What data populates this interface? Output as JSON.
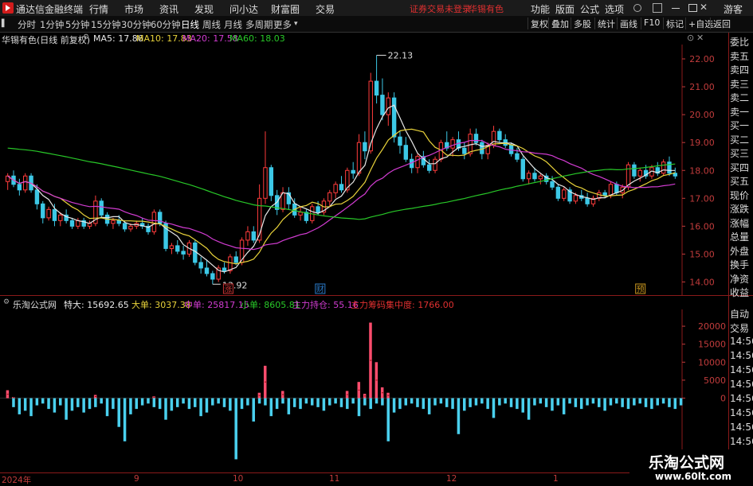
{
  "app": {
    "name": "通达信金融终端",
    "menu": [
      "行情",
      "市场",
      "资讯",
      "发现",
      "问小达",
      "财富圈",
      "交易"
    ],
    "status": "证券交易未登录",
    "stock_name": "华锡有色",
    "right_menu": [
      "功能",
      "版面",
      "公式",
      "选项"
    ],
    "user": "游客"
  },
  "toolbar": {
    "periods": [
      "分时",
      "1分钟",
      "5分钟",
      "15分钟",
      "30分钟",
      "60分钟",
      "日线",
      "周线",
      "月线",
      "多周期",
      "更多"
    ],
    "selected": "日线",
    "right": [
      "复权",
      "叠加",
      "多股",
      "统计",
      "画线",
      "F10",
      "标记",
      "+自选",
      "返回"
    ]
  },
  "main_info": {
    "title": "华锡有色(日线 前复权)",
    "ma": [
      {
        "label": "MA5: 17.86",
        "color": "#e8e8e8"
      },
      {
        "label": "MA10: 17.83",
        "color": "#e8d23a"
      },
      {
        "label": "MA20: 17.58",
        "color": "#d23cd2"
      },
      {
        "label": "MA60: 18.03",
        "color": "#28c828"
      }
    ],
    "high_label": "22.13",
    "low_label": "13.92",
    "markers": [
      "涨",
      "财",
      "预"
    ]
  },
  "sub_info": {
    "title": "乐淘公式网",
    "items": [
      {
        "label": "特大: 15692.65",
        "color": "#e8e8e8"
      },
      {
        "label": "大单: 3037.38",
        "color": "#e8d23a"
      },
      {
        "label": "中单: 25817.15",
        "color": "#d23cd2"
      },
      {
        "label": "小单: 8605.81",
        "color": "#28c828"
      },
      {
        "label": "主力持仓: 55.16",
        "color": "#d23cd2"
      },
      {
        "label": "主力筹码集中度: 1766.00",
        "color": "#e03030"
      }
    ]
  },
  "axis": {
    "price": [
      "22.00",
      "21.00",
      "20.00",
      "19.00",
      "18.00",
      "17.00",
      "16.00",
      "15.00",
      "14.00"
    ],
    "volume": [
      "20000",
      "15000",
      "10000",
      "5000",
      "0"
    ],
    "dates": [
      "2024年",
      "9",
      "10",
      "11",
      "12",
      "1"
    ]
  },
  "right_panel": {
    "top": [
      "委比",
      "卖五",
      "卖四",
      "卖三",
      "卖二",
      "卖一",
      "买一",
      "买二",
      "买三",
      "买四",
      "买五",
      "现价",
      "涨跌",
      "涨幅",
      "总量",
      "外盘",
      "换手",
      "净资",
      "收益"
    ],
    "bottom": [
      "自动",
      "交易",
      "14:56",
      "14:56",
      "14:56",
      "14:56",
      "14:56",
      "14:56",
      "14:56",
      "14:56"
    ]
  },
  "watermark": {
    "name": "乐淘公式网",
    "url": "www.60lt.com"
  },
  "chart_data": {
    "type": "candlestick",
    "y_range": [
      13.7,
      22.4
    ],
    "candles": [
      [
        17.6,
        17.9,
        17.3,
        17.8
      ],
      [
        17.8,
        18.0,
        17.4,
        17.5
      ],
      [
        17.5,
        17.7,
        17.1,
        17.3
      ],
      [
        17.3,
        17.9,
        17.2,
        17.8
      ],
      [
        17.8,
        17.9,
        17.2,
        17.3
      ],
      [
        17.3,
        17.5,
        16.6,
        16.8
      ],
      [
        16.8,
        16.9,
        16.1,
        16.3
      ],
      [
        16.3,
        16.7,
        16.2,
        16.6
      ],
      [
        16.6,
        16.8,
        16.0,
        16.2
      ],
      [
        16.2,
        16.5,
        16.0,
        16.4
      ],
      [
        16.4,
        16.6,
        16.1,
        16.2
      ],
      [
        16.2,
        16.3,
        15.9,
        16.0
      ],
      [
        16.0,
        16.3,
        15.9,
        16.2
      ],
      [
        16.2,
        16.3,
        15.9,
        16.0
      ],
      [
        16.0,
        16.2,
        15.9,
        16.1
      ],
      [
        16.1,
        17.1,
        16.0,
        16.9
      ],
      [
        16.9,
        17.0,
        16.3,
        16.4
      ],
      [
        16.4,
        16.5,
        16.0,
        16.1
      ],
      [
        16.1,
        16.3,
        15.9,
        16.2
      ],
      [
        16.2,
        16.4,
        16.0,
        16.1
      ],
      [
        16.1,
        16.2,
        15.8,
        15.9
      ],
      [
        15.9,
        16.1,
        15.8,
        16.0
      ],
      [
        16.0,
        16.2,
        15.9,
        16.1
      ],
      [
        16.1,
        16.3,
        15.9,
        16.0
      ],
      [
        16.0,
        16.1,
        15.7,
        15.8
      ],
      [
        15.8,
        16.6,
        15.7,
        16.5
      ],
      [
        16.5,
        16.6,
        16.0,
        16.1
      ],
      [
        16.1,
        16.2,
        15.1,
        15.2
      ],
      [
        15.2,
        15.4,
        15.0,
        15.3
      ],
      [
        15.3,
        15.5,
        15.0,
        15.1
      ],
      [
        15.1,
        15.3,
        14.8,
        15.0
      ],
      [
        15.0,
        15.5,
        14.9,
        15.4
      ],
      [
        15.4,
        15.5,
        14.6,
        14.7
      ],
      [
        14.7,
        14.9,
        14.3,
        14.5
      ],
      [
        14.5,
        14.8,
        14.2,
        14.3
      ],
      [
        14.3,
        14.4,
        13.92,
        14.1
      ],
      [
        14.1,
        14.6,
        14.0,
        14.5
      ],
      [
        14.5,
        14.7,
        14.3,
        14.4
      ],
      [
        14.4,
        15.0,
        14.3,
        14.9
      ],
      [
        14.9,
        15.1,
        14.6,
        14.7
      ],
      [
        14.7,
        15.6,
        14.6,
        15.5
      ],
      [
        15.5,
        16.0,
        15.3,
        15.8
      ],
      [
        15.8,
        16.0,
        15.4,
        15.5
      ],
      [
        15.5,
        17.5,
        15.4,
        17.0
      ],
      [
        17.0,
        19.4,
        16.8,
        18.1
      ],
      [
        18.1,
        18.2,
        16.9,
        17.1
      ],
      [
        17.1,
        17.3,
        16.4,
        16.6
      ],
      [
        16.6,
        17.4,
        16.5,
        17.2
      ],
      [
        17.2,
        17.4,
        16.6,
        16.8
      ],
      [
        16.8,
        17.0,
        16.3,
        16.4
      ],
      [
        16.4,
        16.7,
        16.2,
        16.5
      ],
      [
        16.5,
        16.6,
        16.1,
        16.2
      ],
      [
        16.2,
        16.8,
        16.1,
        16.7
      ],
      [
        16.7,
        16.9,
        16.4,
        16.5
      ],
      [
        16.5,
        17.0,
        16.4,
        16.9
      ],
      [
        16.9,
        17.3,
        16.7,
        17.2
      ],
      [
        17.2,
        17.6,
        17.0,
        17.5
      ],
      [
        17.5,
        17.8,
        17.2,
        17.3
      ],
      [
        17.3,
        18.1,
        17.2,
        18.0
      ],
      [
        18.0,
        18.3,
        17.7,
        17.9
      ],
      [
        17.9,
        19.3,
        17.8,
        19.0
      ],
      [
        19.0,
        19.4,
        18.4,
        18.7
      ],
      [
        18.7,
        21.5,
        18.6,
        21.2
      ],
      [
        21.2,
        22.13,
        20.4,
        20.7
      ],
      [
        20.7,
        21.3,
        19.8,
        20.0
      ],
      [
        20.0,
        20.8,
        19.6,
        20.6
      ],
      [
        20.6,
        20.8,
        19.0,
        19.2
      ],
      [
        19.2,
        19.4,
        18.6,
        18.9
      ],
      [
        18.9,
        19.2,
        18.3,
        18.4
      ],
      [
        18.4,
        18.6,
        17.9,
        18.1
      ],
      [
        18.1,
        18.6,
        17.9,
        18.5
      ],
      [
        18.5,
        18.7,
        18.1,
        18.2
      ],
      [
        18.2,
        18.4,
        17.9,
        18.0
      ],
      [
        18.0,
        18.5,
        17.9,
        18.4
      ],
      [
        18.4,
        19.1,
        18.3,
        19.0
      ],
      [
        19.0,
        19.4,
        18.7,
        18.8
      ],
      [
        18.8,
        19.2,
        18.5,
        19.1
      ],
      [
        19.1,
        19.4,
        18.7,
        18.8
      ],
      [
        18.8,
        19.0,
        18.4,
        18.6
      ],
      [
        18.6,
        19.5,
        18.5,
        19.3
      ],
      [
        19.3,
        19.5,
        18.9,
        19.0
      ],
      [
        19.0,
        19.1,
        18.4,
        18.6
      ],
      [
        18.6,
        19.0,
        18.4,
        18.9
      ],
      [
        18.9,
        19.6,
        18.8,
        19.4
      ],
      [
        19.4,
        19.5,
        19.0,
        19.1
      ],
      [
        19.1,
        19.3,
        18.8,
        18.9
      ],
      [
        18.9,
        19.0,
        18.5,
        18.6
      ],
      [
        18.6,
        18.8,
        18.3,
        18.4
      ],
      [
        18.4,
        18.5,
        17.6,
        17.7
      ],
      [
        17.7,
        18.0,
        17.5,
        17.9
      ],
      [
        17.9,
        18.1,
        17.6,
        17.7
      ],
      [
        17.7,
        17.9,
        17.5,
        17.8
      ],
      [
        17.8,
        17.9,
        17.5,
        17.6
      ],
      [
        17.6,
        17.8,
        17.3,
        17.4
      ],
      [
        17.4,
        17.5,
        16.9,
        17.0
      ],
      [
        17.0,
        17.4,
        16.9,
        17.3
      ],
      [
        17.3,
        17.4,
        16.8,
        16.9
      ],
      [
        16.9,
        17.2,
        16.8,
        17.1
      ],
      [
        17.1,
        17.3,
        16.9,
        17.0
      ],
      [
        17.0,
        17.2,
        16.7,
        16.8
      ],
      [
        16.8,
        17.1,
        16.7,
        17.0
      ],
      [
        17.0,
        17.3,
        16.9,
        17.2
      ],
      [
        17.2,
        17.3,
        17.0,
        17.1
      ],
      [
        17.1,
        17.6,
        17.0,
        17.5
      ],
      [
        17.5,
        17.6,
        17.1,
        17.2
      ],
      [
        17.2,
        17.5,
        17.0,
        17.4
      ],
      [
        17.4,
        18.3,
        17.3,
        18.2
      ],
      [
        18.2,
        18.3,
        17.7,
        17.8
      ],
      [
        17.8,
        18.1,
        17.6,
        18.0
      ],
      [
        18.0,
        18.2,
        17.7,
        17.8
      ],
      [
        17.8,
        18.2,
        17.7,
        18.1
      ],
      [
        18.1,
        18.3,
        17.8,
        17.9
      ],
      [
        17.9,
        18.4,
        17.8,
        18.3
      ],
      [
        18.3,
        18.5,
        17.8,
        17.9
      ],
      [
        17.9,
        18.1,
        17.7,
        17.8
      ]
    ],
    "volume_positive": [
      2200,
      300,
      0,
      0,
      0,
      0,
      0,
      0,
      0,
      0,
      0,
      0,
      0,
      0,
      0,
      900,
      0,
      0,
      0,
      0,
      0,
      0,
      0,
      0,
      0,
      500,
      0,
      0,
      0,
      0,
      0,
      0,
      0,
      0,
      0,
      0,
      0,
      0,
      0,
      0,
      0,
      0,
      0,
      1500,
      9000,
      0,
      0,
      2000,
      0,
      0,
      0,
      0,
      0,
      0,
      0,
      0,
      0,
      0,
      2000,
      0,
      4500,
      1200,
      21000,
      10000,
      3000,
      1500,
      0,
      0,
      0,
      0,
      0,
      0,
      0,
      0,
      0,
      0,
      0,
      0,
      0,
      0,
      0,
      0,
      0,
      0,
      0,
      0,
      0,
      0,
      0,
      0,
      0,
      0,
      0,
      0,
      0,
      0,
      0,
      0,
      0,
      0,
      0,
      0,
      0,
      0,
      0,
      0,
      0,
      0,
      0,
      0,
      0,
      0,
      0,
      0,
      0
    ],
    "volume_negative": [
      0,
      -2500,
      -4500,
      -3500,
      -5000,
      -2000,
      -1500,
      -3000,
      -4000,
      -2000,
      -6000,
      -3500,
      -2500,
      -4000,
      -3000,
      -2500,
      -1500,
      -5000,
      -3000,
      -8000,
      -12000,
      -4500,
      -3000,
      -2000,
      -1500,
      -2500,
      -3000,
      -6000,
      -3500,
      -2500,
      -1500,
      -3000,
      -2500,
      -5000,
      -4000,
      -2000,
      -1500,
      -2500,
      -3500,
      -17000,
      -3000,
      -2000,
      -6500,
      -1500,
      -2000,
      -5000,
      -3000,
      -1500,
      -4500,
      -2500,
      -3000,
      -1500,
      -2000,
      -2500,
      -3500,
      -2000,
      -1500,
      -2500,
      -3000,
      -1500,
      -5000,
      -2000,
      -3000,
      -1500,
      -2000,
      -12000,
      -4000,
      -3000,
      -2000,
      -1500,
      -2500,
      -3000,
      -4500,
      -2000,
      -1500,
      -2500,
      -3000,
      -10000,
      -3500,
      -2500,
      -2000,
      -1500,
      -3000,
      -5500,
      -2000,
      -1500,
      -2500,
      -3000,
      -4000,
      -6000,
      -2000,
      -1500,
      -2500,
      -3500,
      -2000,
      -4500,
      -1500,
      -2500,
      -3000,
      -2000,
      -1500,
      -2500,
      -3500,
      -2000,
      -1500,
      -2500,
      -3000,
      -2000,
      -1500,
      -2500,
      -3000,
      -2000,
      -1500,
      -2500,
      -3000,
      -2000
    ],
    "volume_range": [
      -20000,
      24000
    ]
  }
}
